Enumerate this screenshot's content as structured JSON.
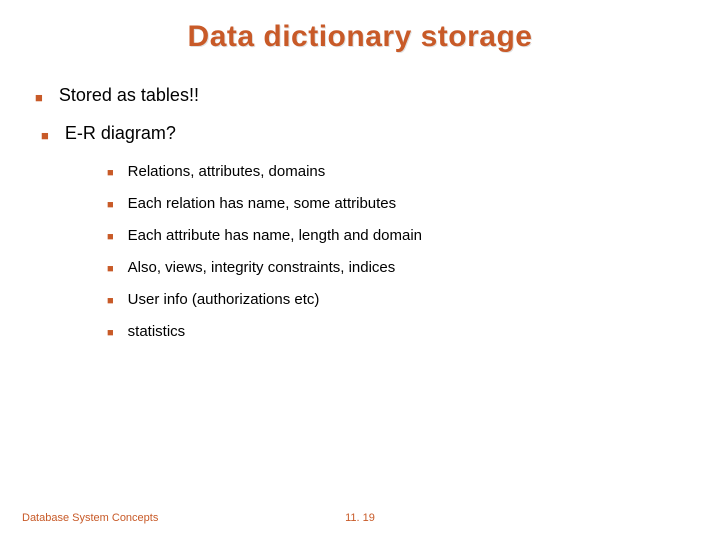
{
  "title": "Data dictionary storage",
  "top_items": [
    {
      "text": "Stored as tables!!"
    },
    {
      "text": "E-R diagram?"
    }
  ],
  "sub_items": [
    {
      "text": "Relations, attributes, domains"
    },
    {
      "text": "Each relation has name, some attributes"
    },
    {
      "text": "Each attribute has name, length and domain"
    },
    {
      "text": "Also, views, integrity constraints, indices"
    },
    {
      "text": "User info (authorizations etc)"
    },
    {
      "text": "statistics"
    }
  ],
  "footer": {
    "left": "Database System Concepts",
    "center": "11. 19"
  },
  "colors": {
    "accent": "#c85a28"
  }
}
